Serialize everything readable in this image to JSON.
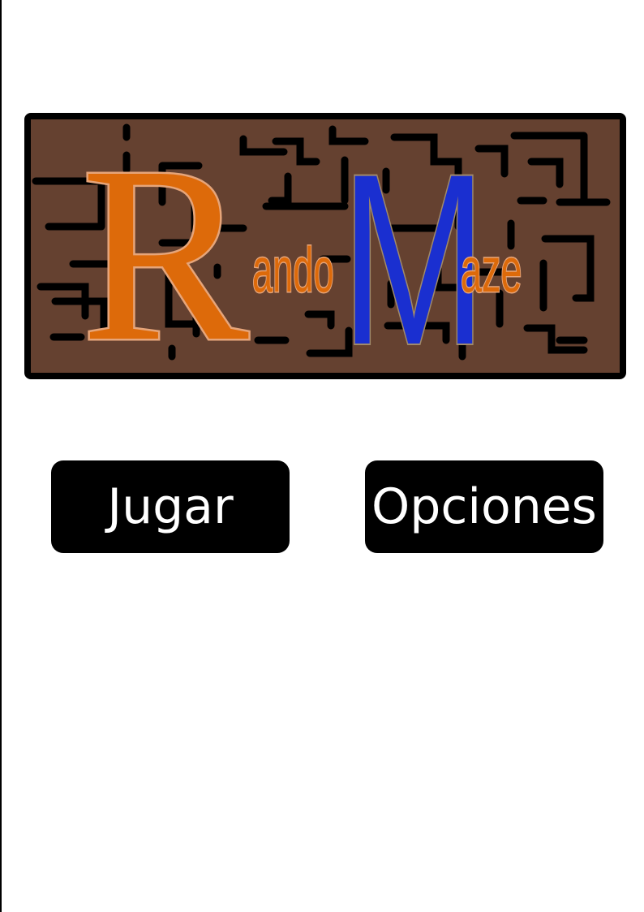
{
  "logo": {
    "letter_r": "R",
    "word_r": "ando",
    "letter_m": "M",
    "word_m": "aze",
    "colors": {
      "board": "#654130",
      "border": "#000000",
      "walls": "#000000",
      "orange": "#dd6a0a",
      "orange_outline": "#e6a57a",
      "blue": "#1a2fd0",
      "blue_outline": "#a08a6a"
    }
  },
  "menu": {
    "play_label": "Jugar",
    "options_label": "Opciones"
  }
}
